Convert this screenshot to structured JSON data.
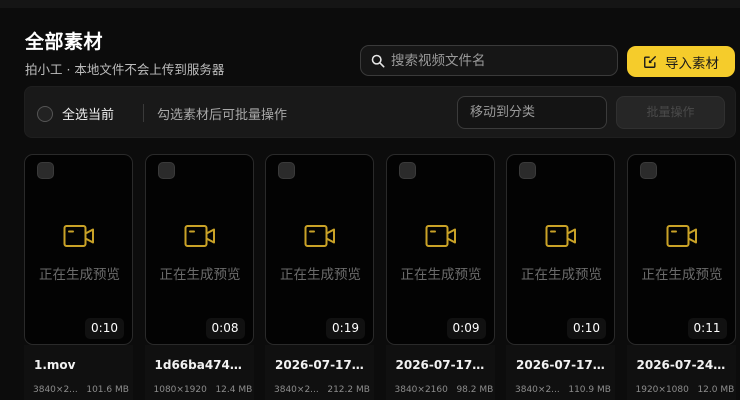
{
  "header": {
    "title": "全部素材",
    "subtitle": "拍小工 · 本地文件不会上传到服务器"
  },
  "search": {
    "placeholder": "搜索视频文件名",
    "value": ""
  },
  "import_button": {
    "label": "导入素材"
  },
  "toolbar": {
    "select_all_label": "全选当前",
    "hint": "勾选素材后可批量操作",
    "move_placeholder": "移动到分类",
    "batch_label": "批量操作"
  },
  "card_common": {
    "generating_label": "正在生成预览"
  },
  "cards": [
    {
      "duration": "0:10",
      "name": "1.mov",
      "resolution": "3840×2...",
      "size": "101.6 MB"
    },
    {
      "duration": "0:08",
      "name": "1d66ba4746f...",
      "resolution": "1080×1920",
      "size": "12.4 MB"
    },
    {
      "duration": "0:19",
      "name": "2026-07-17 1...",
      "resolution": "3840×2...",
      "size": "212.2 MB"
    },
    {
      "duration": "0:09",
      "name": "2026-07-17 1...",
      "resolution": "3840×2160",
      "size": "98.2 MB"
    },
    {
      "duration": "0:10",
      "name": "2026-07-17 1...",
      "resolution": "3840×2...",
      "size": "110.9 MB"
    },
    {
      "duration": "0:11",
      "name": "2026-07-24 1...",
      "resolution": "1920×1080",
      "size": "12.0 MB"
    }
  ],
  "colors": {
    "accent": "#f5cc2b",
    "background": "#0c0c0c",
    "icon": "#c9a227"
  }
}
